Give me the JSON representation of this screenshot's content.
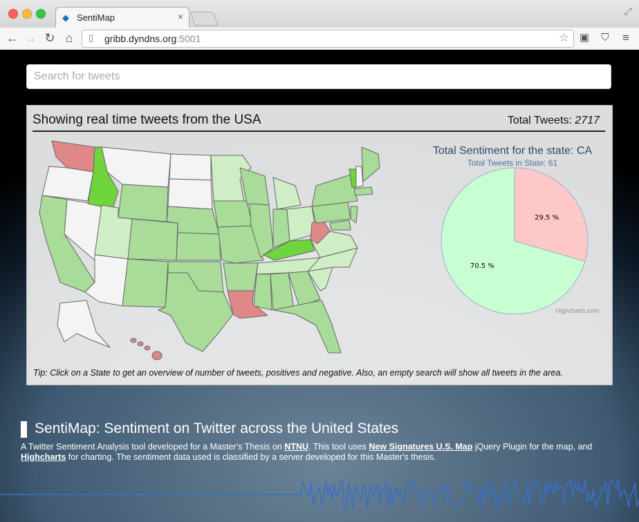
{
  "browser": {
    "tab_title": "SentiMap",
    "tab_close": "×",
    "url_host": "gribb.dyndns.org",
    "url_port": ":5001"
  },
  "search": {
    "placeholder": "Search for tweets"
  },
  "panel": {
    "title": "Showing real time tweets from the USA",
    "total_label": "Total Tweets: ",
    "total_value": "2717",
    "tip": "Tip: Click on a State to get an overview of number of tweets, positives and negative. Also, an empty search will show all tweets in the area."
  },
  "chart_data": {
    "type": "pie",
    "title": "Total Sentiment for the state: CA",
    "subtitle": "Total Tweets in State: 61",
    "series": [
      {
        "name": "",
        "values": [
          29.5,
          70.5
        ]
      }
    ],
    "labels": [
      "29.5 %",
      "70.5 %"
    ],
    "colors": [
      "#ffc8c8",
      "#c8ffd2"
    ],
    "credit": "Highcharts.com"
  },
  "colors": {
    "positive_strong": "#6ed63c",
    "positive_mid": "#a8dc98",
    "positive_light": "#cfeec6",
    "negative": "#e08888",
    "neutral": "#f4f4f4"
  },
  "about": {
    "title": "SentiMap: Sentiment on Twitter across the United States",
    "text1": "A Twitter Sentiment Analysis tool developed for a Master's Thesis on ",
    "link1": "NTNU",
    "text2": ". This tool uses ",
    "link2": "New Signatures U.S. Map",
    "text3": " jQuery Plugin for the map, and ",
    "link3": "Highcharts",
    "text4": " for charting. The sentiment data used is classified by a server developed for this Master's thesis."
  }
}
